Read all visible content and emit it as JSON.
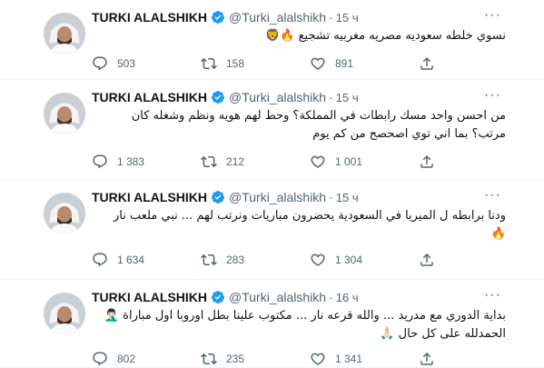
{
  "tweets": [
    {
      "name": "TURKI ALALSHIKH",
      "handle": "@Turki_alalshikh",
      "time": "15 ч",
      "text_lines": [
        "نسوي خلطه سعوديه مصريه مغربيه تشجيع 🔥🦁"
      ],
      "replies": "503",
      "retweets": "158",
      "likes": "891"
    },
    {
      "name": "TURKI ALALSHIKH",
      "handle": "@Turki_alalshikh",
      "time": "15 ч",
      "text_lines": [
        "من احسن واحد مسك رابطات في المملكة؟ وحط لهم هويه ونظم وشغله كان",
        "مرتب؟ بما اني توي اصحصح من كم يوم"
      ],
      "replies": "1 383",
      "retweets": "212",
      "likes": "1 001"
    },
    {
      "name": "TURKI ALALSHIKH",
      "handle": "@Turki_alalshikh",
      "time": "15 ч",
      "text_lines": [
        "ودنا برابطه ل الميريا في السعودية يحضرون مباريات ونرتب لهم ... نبي ملعب نار",
        "🔥"
      ],
      "replies": "1 634",
      "retweets": "283",
      "likes": "1 304"
    },
    {
      "name": "TURKI ALALSHIKH",
      "handle": "@Turki_alalshikh",
      "time": "16 ч",
      "text_lines": [
        "بداية الدوري مع مدريد ... والله قرعه نار ... مكتوب علينا بطل اوروبا اول مباراة 🤦🏻‍♂️",
        "الحمدلله على كل حال 🙏🏻"
      ],
      "replies": "802",
      "retweets": "235",
      "likes": "1 341"
    }
  ],
  "colors": {
    "verified": "#1d9bf0",
    "muted": "#536471",
    "divider": "#eff3f4"
  },
  "icons": {
    "reply": "reply-icon",
    "retweet": "retweet-icon",
    "like": "heart-icon",
    "share": "share-icon",
    "more": "more-icon",
    "verified": "verified-badge-icon"
  }
}
